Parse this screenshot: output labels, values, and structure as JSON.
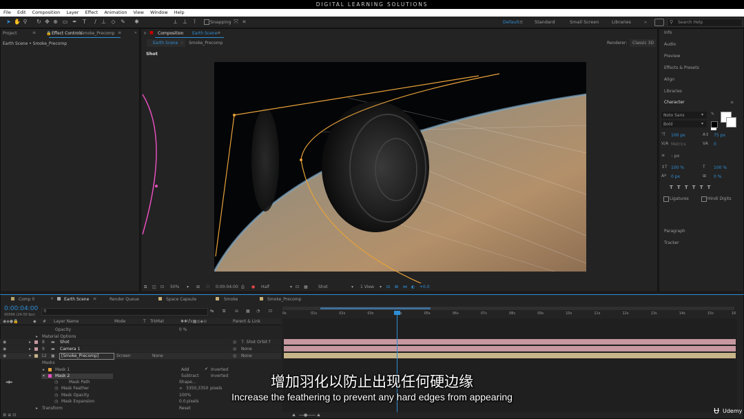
{
  "app_title": "DIGITAL LEARNING SOLUTIONS",
  "menu": [
    "File",
    "Edit",
    "Composition",
    "Layer",
    "Effect",
    "Animation",
    "View",
    "Window",
    "Help"
  ],
  "toolbar": {
    "snapping": "Snapping"
  },
  "workspaces": {
    "items": [
      "Default",
      "Standard",
      "Small Screen",
      "Libraries"
    ],
    "search": "Search Help"
  },
  "project_panel": {
    "tab": "Project",
    "effect_controls_prefix": "Effect Controls",
    "effect_controls_layer": "Smoke_Precomp",
    "breadcrumb": "Earth Scene • Smoke_Precomp"
  },
  "composition_panel": {
    "tab_prefix": "Composition",
    "tab_name": "Earth Scene",
    "sub_tabs": [
      "Earth Scene",
      "Smoke_Precomp"
    ],
    "renderer_label": "Renderer:",
    "renderer": "Classic 3D",
    "camera_label": "Shot",
    "footer": {
      "zoom": "50%",
      "time": "0:00:04:00",
      "resolution": "Half",
      "camera": "Shot",
      "view": "1 View",
      "exposure": "+0.0"
    }
  },
  "right_panels": {
    "items": [
      "Info",
      "Audio",
      "Preview",
      "Effects & Presets",
      "Align",
      "Libraries",
      "Character"
    ],
    "character": {
      "font": "Noto Sans",
      "style": "Bold",
      "size": "100 px",
      "leading": "75 px",
      "kerning": "Metrics",
      "tracking": "0",
      "stroke": "– px",
      "vscale": "100 %",
      "hscale": "100 %",
      "baseline": "0 px",
      "tsume": "0 %",
      "ligatures": "Ligatures",
      "hindi": "Hindi Digits"
    },
    "bottom": [
      "Paragraph",
      "Tracker"
    ]
  },
  "timeline": {
    "tabs": [
      "Comp 0",
      "Earth Scene",
      "Render Queue",
      "Space Capsule",
      "Smoke",
      "Smoke_Precomp"
    ],
    "tab_colors": [
      "#b4a36b",
      "#a9a9a9",
      "#9a9a9a",
      "#c9b27a",
      "#c9b27a",
      "#c9b27a"
    ],
    "timecode": "0:00:04:00",
    "frame_info": "00096 (24.00 fps)",
    "columns": {
      "layer_name": "Layer Name",
      "mode": "Mode",
      "t": "T",
      "trkmat": "TrkMat",
      "parent": "Parent & Link"
    },
    "ruler": [
      "0s",
      "01s",
      "02s",
      "03s",
      "04s",
      "05s",
      "06s",
      "07s",
      "08s",
      "09s",
      "10s",
      "11s",
      "12s",
      "13s",
      "14s",
      "15s",
      "16"
    ],
    "rows": {
      "opacity": {
        "label": "Opacity",
        "value": "0 %"
      },
      "material_options": "Material Options",
      "layer8": {
        "num": "8",
        "name": "Shot",
        "parent": "7. Shot Orbit f"
      },
      "layer9": {
        "num": "9",
        "name": "Camera 1",
        "parent": "None"
      },
      "layer12": {
        "num": "12",
        "name": "[Smoke_Precomp]",
        "mode": "Screen",
        "trkmat": "None",
        "parent": "None"
      },
      "masks": "Masks",
      "mask1": {
        "name": "Mask 1",
        "mode": "Add",
        "inverted": "Inverted"
      },
      "mask2": {
        "name": "Mask 2",
        "mode": "Subtract",
        "inverted": "Inverted"
      },
      "mask_path": {
        "label": "Mask Path",
        "value": "Shape..."
      },
      "mask_feather": {
        "label": "Mask Feather",
        "value": "3350,3350",
        "unit": "pixels"
      },
      "mask_opacity": {
        "label": "Mask Opacity",
        "value": "100%"
      },
      "mask_expansion": {
        "label": "Mask Expansion",
        "value": "0.0",
        "unit": "pixels"
      },
      "transform": {
        "label": "Transform",
        "value": "Reset"
      }
    }
  },
  "subtitles": {
    "cn": "增加羽化以防止出现任何硬边缘",
    "en": "Increase the feathering to prevent any hard edges from appearing"
  },
  "watermark": "Udemy",
  "colors": {
    "accent": "#2e8fd6",
    "layer_shot": "#c7989f",
    "layer_camera": "#c7989f",
    "layer_precomp": "#c7b488",
    "mask_path": "#e8a33a",
    "motion_path": "#e84fbf"
  }
}
